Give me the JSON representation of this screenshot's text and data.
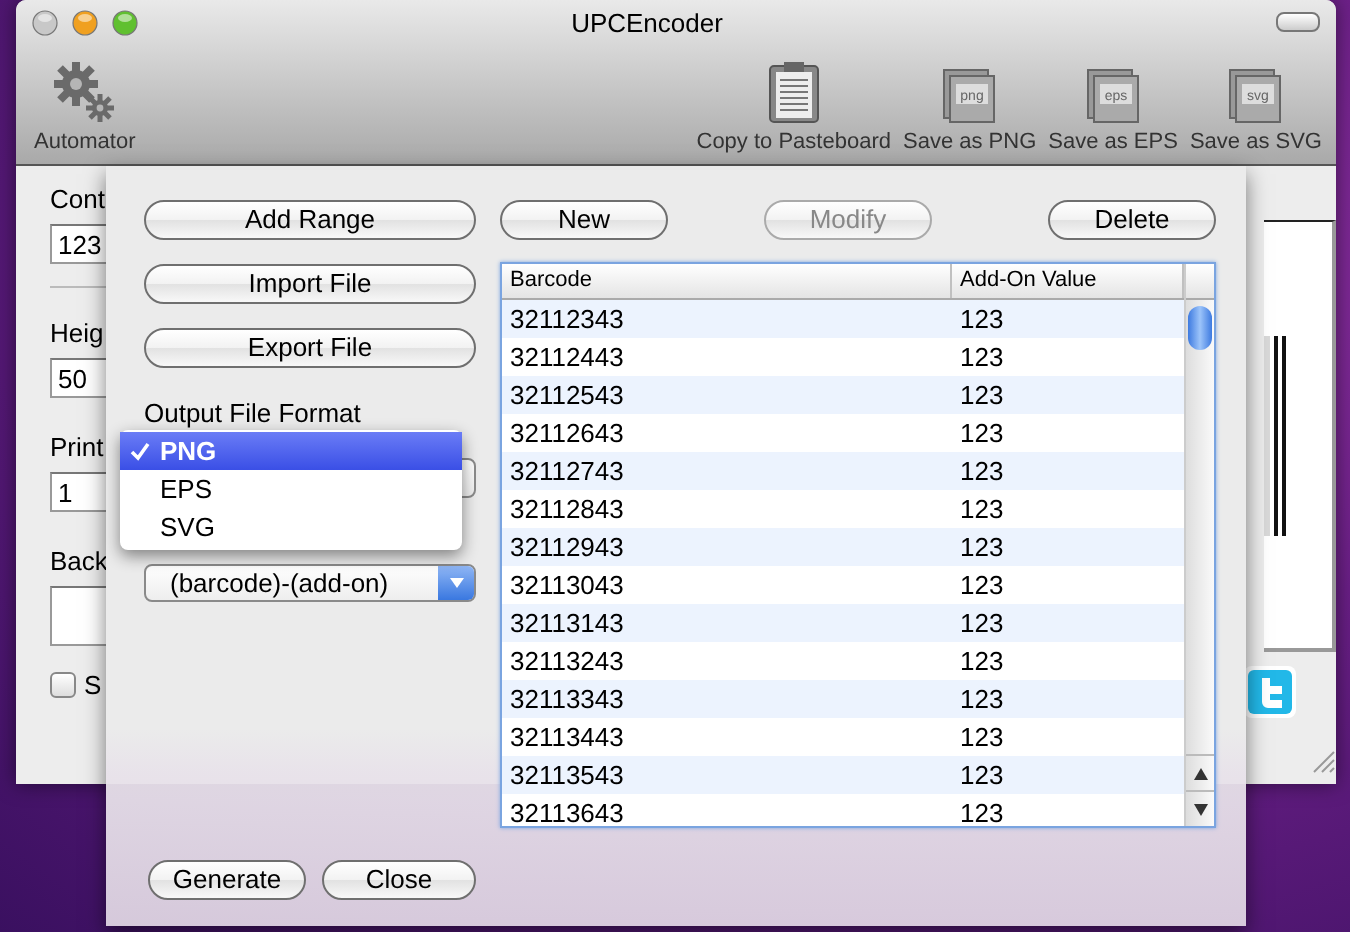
{
  "window": {
    "title": "UPCEncoder"
  },
  "toolbar": {
    "left": [
      {
        "label": "Automator",
        "kind": "gear"
      }
    ],
    "right": [
      {
        "label": "Copy to Pasteboard",
        "kind": "clipboard"
      },
      {
        "label": "Save as PNG",
        "kind": "file",
        "icon_text": "png"
      },
      {
        "label": "Save as EPS",
        "kind": "file",
        "icon_text": "eps"
      },
      {
        "label": "Save as SVG",
        "kind": "file",
        "icon_text": "svg"
      }
    ]
  },
  "form": {
    "fields": [
      {
        "label": "Cont",
        "value": "123"
      },
      {
        "label": "Heig",
        "value": "50"
      },
      {
        "label": "Print",
        "value": "1"
      },
      {
        "label": "Back"
      }
    ],
    "checkbox": {
      "label": "S",
      "checked": false
    }
  },
  "sheet": {
    "left_buttons": [
      "Add Range",
      "Import File",
      "Export File"
    ],
    "output_format_label": "Output File Format",
    "format_menu": [
      {
        "label": "PNG",
        "selected": true
      },
      {
        "label": "EPS",
        "selected": false
      },
      {
        "label": "SVG",
        "selected": false
      }
    ],
    "naming_popup": "(barcode)-(add-on)",
    "top_buttons": [
      {
        "label": "New",
        "disabled": false
      },
      {
        "label": "Modify",
        "disabled": true
      },
      {
        "label": "Delete",
        "disabled": false
      }
    ],
    "table": {
      "columns": [
        "Barcode",
        "Add-On Value"
      ],
      "rows": [
        [
          "32112343",
          "123"
        ],
        [
          "32112443",
          "123"
        ],
        [
          "32112543",
          "123"
        ],
        [
          "32112643",
          "123"
        ],
        [
          "32112743",
          "123"
        ],
        [
          "32112843",
          "123"
        ],
        [
          "32112943",
          "123"
        ],
        [
          "32113043",
          "123"
        ],
        [
          "32113143",
          "123"
        ],
        [
          "32113243",
          "123"
        ],
        [
          "32113343",
          "123"
        ],
        [
          "32113443",
          "123"
        ],
        [
          "32113543",
          "123"
        ],
        [
          "32113643",
          "123"
        ]
      ]
    },
    "bottom_buttons": [
      "Generate",
      "Close"
    ]
  }
}
